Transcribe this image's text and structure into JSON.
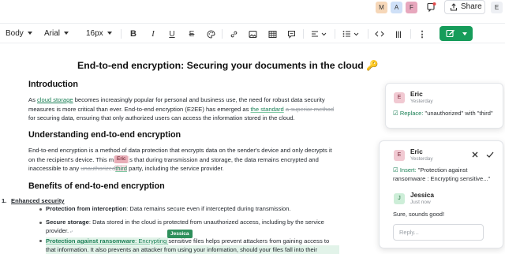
{
  "header": {
    "avatars": [
      {
        "letter": "M",
        "color": "#f6d7b8"
      },
      {
        "letter": "A",
        "color": "#cfe0f7"
      },
      {
        "letter": "F",
        "color": "#e7a7bd"
      }
    ],
    "share_label": "Share",
    "user_avatar": "E"
  },
  "toolbar": {
    "style": "Body",
    "font": "Arial",
    "size": "16px",
    "accent": "#169c5a"
  },
  "doc": {
    "title": "End-to-end encryption: Securing your documents in the cloud",
    "title_icon": "🔑",
    "intro_heading": "Introduction",
    "intro": {
      "p1": "As ",
      "link": "cloud storage",
      "p2": " becomes increasingly popular for personal and business use, the need for robust data security",
      "line2": "measures is more critical than ever. End-to-end encryption (E2EE) has emerged as ",
      "ins1": "the standard",
      "del1": "a superior method",
      "line3": "for securing data, ensuring that only authorized users can access the information stored in the cloud."
    },
    "understanding_heading": "Understanding end-to-end encryption",
    "understanding": {
      "line1": "End-to-end encryption is a method of data protection that encrypts data on the sender's device and only decrypts it",
      "line2a": "on the recipient's device. This m",
      "cursor_name": "Eric",
      "line2b": "s that during transmission and storage, the data remains encrypted and",
      "line3a": "inaccessible to any ",
      "del": "unauthorized",
      "ins": "third",
      "line3b": " party, including the service provider."
    },
    "benefits_heading": "Benefits of end-to-end encryption",
    "list_num": "1.",
    "list_title": "Enhanced security",
    "bullets": [
      {
        "bold": "Protection from interception",
        "text": ": Data remains secure even if intercepted during transmission."
      },
      {
        "bold": "Secure storage",
        "text": ": Data stored in the cloud is protected from unauthorized access, including by the service",
        "cont": "provider."
      },
      {
        "bold": "Protection against ransomware",
        "ins": ": Encrypting ",
        "cursor_name": "Jessica",
        "text": "sensitive files helps prevent attackers from gaining access to",
        "cont": "that information. It also prevents an attacker from using your information, should your files fall into their"
      }
    ]
  },
  "comments": [
    {
      "author": "Eric",
      "avatar": "E",
      "time": "Yesterday",
      "action": "Replace:",
      "text": "\"unauthorized\" with \"third\""
    },
    {
      "author": "Eric",
      "avatar": "E",
      "time": "Yesterday",
      "action": "Insert:",
      "text": "\"Protection against ransomware : Encrypting sensitive...\"",
      "reply": {
        "author": "Jessica",
        "avatar": "J",
        "time": "Just now",
        "text": "Sure, sounds good!"
      },
      "reply_placeholder": "Reply..."
    }
  ]
}
